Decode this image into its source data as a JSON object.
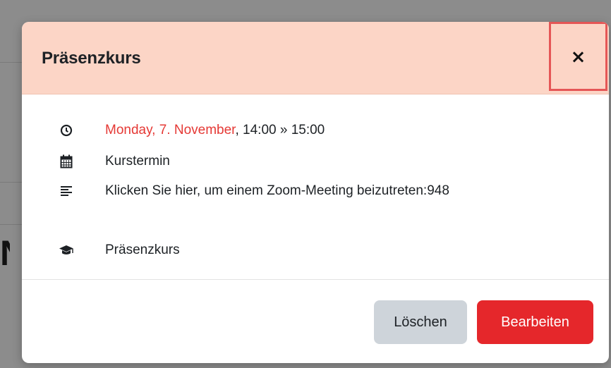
{
  "modal": {
    "title": "Präsenzkurs",
    "close_label": "×"
  },
  "event": {
    "date_link": "Monday, 7. November",
    "time_range": ", 14:00 » 15:00",
    "event_type": "Kurstermin",
    "description_link": "Klicken Sie hier, um einem Zoom-Meeting beizutreten:948",
    "course_link": "Präsenzkurs"
  },
  "icons": {
    "time": "clock-icon",
    "type": "calendar-icon",
    "description": "align-left-icon",
    "course": "graduation-cap-icon"
  },
  "footer": {
    "delete_label": "Löschen",
    "edit_label": "Bearbeiten"
  },
  "colors": {
    "header_bg": "#fcd5c6",
    "link": "#e53935",
    "primary_button": "#e5272b",
    "secondary_button": "#ced4da",
    "close_highlight": "#e55656"
  }
}
